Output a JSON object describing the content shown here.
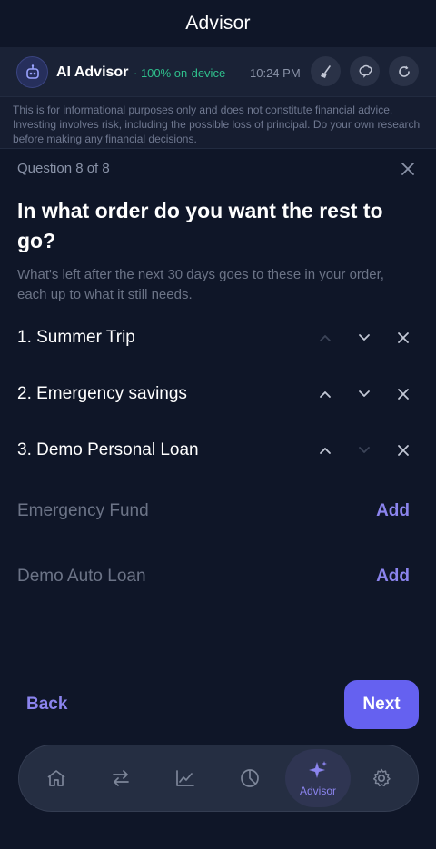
{
  "header": {
    "title": "Advisor"
  },
  "advisor": {
    "name": "AI Advisor",
    "status": "· 100% on-device",
    "time": "10:24 PM",
    "actions": [
      "broom-icon",
      "brain-icon",
      "refresh-icon"
    ]
  },
  "disclaimer": "This is for informational purposes only and does not constitute financial advice. Investing involves risk, including the possible loss of principal. Do your own research before making any financial decisions.",
  "question": {
    "counter": "Question 8 of 8",
    "title": "In what order do you want the rest to go?",
    "subtitle": "What's left after the next 30 days goes to these in your order, each up to what it still needs."
  },
  "ordered_items": [
    {
      "label": "1. Summer Trip",
      "up_enabled": false,
      "down_enabled": true
    },
    {
      "label": "2. Emergency savings",
      "up_enabled": true,
      "down_enabled": true
    },
    {
      "label": "3. Demo Personal Loan",
      "up_enabled": true,
      "down_enabled": false
    }
  ],
  "available_items": [
    {
      "label": "Emergency Fund",
      "action": "Add"
    },
    {
      "label": "Demo Auto Loan",
      "action": "Add"
    }
  ],
  "footer": {
    "back_label": "Back",
    "next_label": "Next"
  },
  "tabbar": {
    "tabs": [
      {
        "icon": "home-icon",
        "label": ""
      },
      {
        "icon": "transfer-icon",
        "label": ""
      },
      {
        "icon": "trend-icon",
        "label": ""
      },
      {
        "icon": "pie-icon",
        "label": ""
      },
      {
        "icon": "sparkle-icon",
        "label": "Advisor"
      },
      {
        "icon": "gear-icon",
        "label": ""
      }
    ]
  },
  "colors": {
    "accent": "#6561f0",
    "status_green": "#2fbf8c",
    "background": "#0f1628"
  }
}
